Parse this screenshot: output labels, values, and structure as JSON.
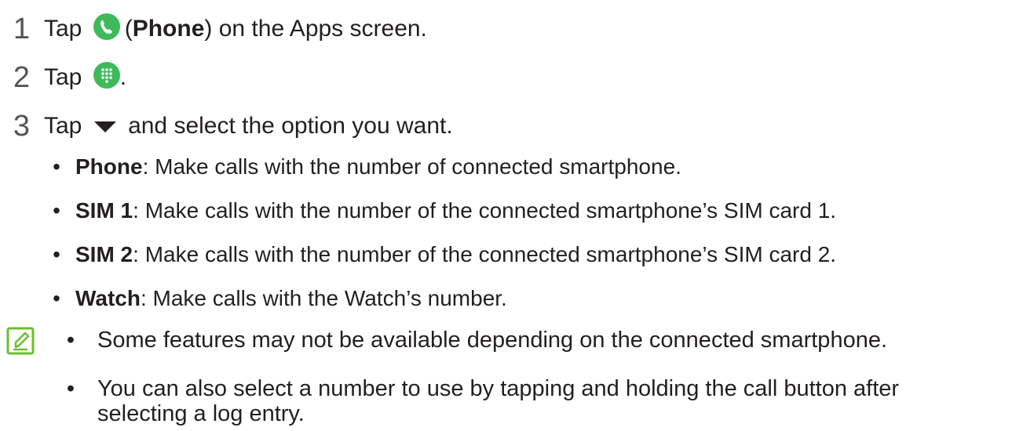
{
  "steps": [
    {
      "num": "1",
      "pre": "Tap",
      "icon": "phone-icon",
      "bold": "Phone",
      "post": ") on the Apps screen.",
      "paren_open": "("
    },
    {
      "num": "2",
      "pre": "Tap",
      "icon": "keypad-icon",
      "post": "."
    },
    {
      "num": "3",
      "pre": "Tap",
      "icon": "dropdown-triangle-icon",
      "post": "and select the option you want."
    }
  ],
  "options": [
    {
      "bold": "Phone",
      "text": ": Make calls with the number of connected smartphone."
    },
    {
      "bold": "SIM 1",
      "text": ": Make calls with the number of the connected smartphone’s SIM card 1."
    },
    {
      "bold": "SIM 2",
      "text": ": Make calls with the number of the connected smartphone’s SIM card 2."
    },
    {
      "bold": "Watch",
      "text": ": Make calls with the Watch’s number."
    }
  ],
  "notes": [
    {
      "text": "Some features may not be available depending on the connected smartphone."
    },
    {
      "text_line1": "You can also select a number to use by tapping and holding the call button after",
      "text_line2": "selecting a log entry."
    }
  ],
  "bullet_char": "•",
  "colors": {
    "accent_green": "#3dbb5a",
    "note_icon": "#6cbf2c",
    "text": "#231f20"
  }
}
